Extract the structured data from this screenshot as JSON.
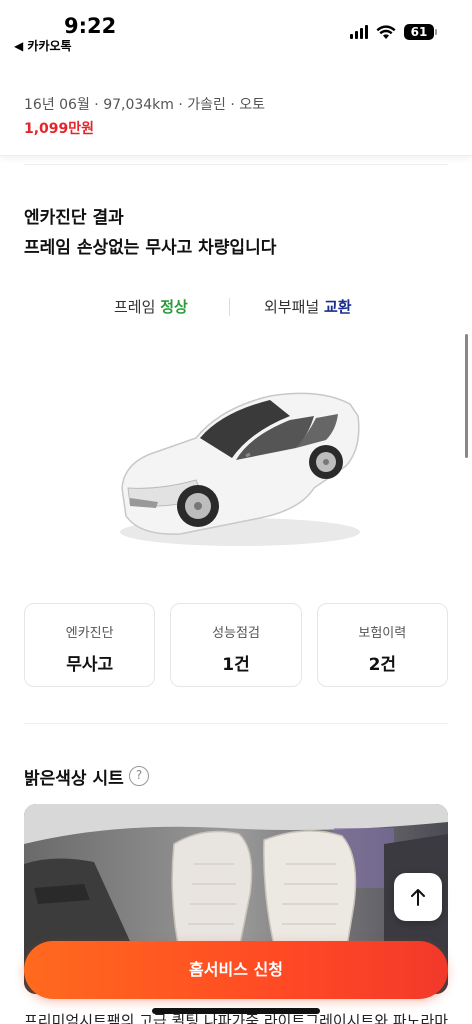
{
  "status_bar": {
    "time": "9:22",
    "back_app": "◀ 카카오톡",
    "battery": "61",
    "icons": [
      "signal-icon",
      "wifi-icon",
      "battery-icon"
    ]
  },
  "summary": {
    "meta": "16년 06월 · 97,034km · 가솔린 · 오토",
    "price": "1,099만원"
  },
  "diagnosis": {
    "title_line1": "엔카진단 결과",
    "title_line2": "프레임 손상없는 무사고 차량입니다",
    "frame_label": "프레임",
    "frame_value": "정상",
    "panel_label": "외부패널",
    "panel_value": "교환"
  },
  "stats": [
    {
      "label": "엔카진단",
      "value": "무사고"
    },
    {
      "label": "성능점검",
      "value": "1건"
    },
    {
      "label": "보험이력",
      "value": "2건"
    }
  ],
  "seat": {
    "title": "밝은색상 시트",
    "help_icon": "?"
  },
  "cta": {
    "label": "홈서비스 신청"
  },
  "description": "프리미엄시트팩의 고급 퀼팅 나파가죽 라이트그레이시트와 파노라마",
  "colors": {
    "price": "#e5252a",
    "good": "#2a9d3a",
    "swap": "#1b2f8f",
    "cta": "#ff5522"
  }
}
